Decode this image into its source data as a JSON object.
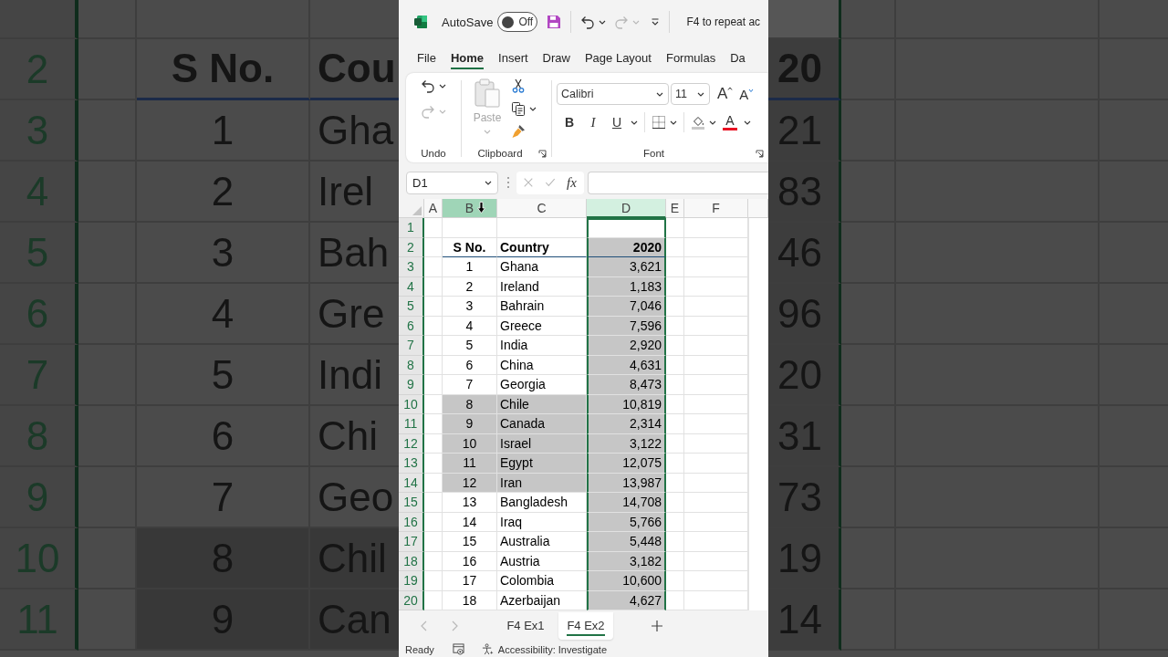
{
  "backdrop": {
    "left": {
      "rows": [
        {
          "number": "2",
          "kind": "header",
          "s_no": "S No.",
          "country": "Cou",
          "filled": false
        },
        {
          "number": "3",
          "kind": "data",
          "s_no": "1",
          "country": "Gha",
          "filled": false
        },
        {
          "number": "4",
          "kind": "data",
          "s_no": "2",
          "country": "Irel",
          "filled": false
        },
        {
          "number": "5",
          "kind": "data",
          "s_no": "3",
          "country": "Bah",
          "filled": false
        },
        {
          "number": "6",
          "kind": "data",
          "s_no": "4",
          "country": "Gre",
          "filled": false
        },
        {
          "number": "7",
          "kind": "data",
          "s_no": "5",
          "country": "Indi",
          "filled": false
        },
        {
          "number": "8",
          "kind": "data",
          "s_no": "6",
          "country": "Chi",
          "filled": false
        },
        {
          "number": "9",
          "kind": "data",
          "s_no": "7",
          "country": "Geo",
          "filled": false
        },
        {
          "number": "10",
          "kind": "data",
          "s_no": "8",
          "country": "Chil",
          "filled": true
        },
        {
          "number": "11",
          "kind": "data",
          "s_no": "9",
          "country": "Can",
          "filled": true
        }
      ]
    },
    "right": {
      "rows": [
        {
          "kind": "header",
          "value": "20",
          "filled": true
        },
        {
          "kind": "data",
          "value": "21",
          "filled": true
        },
        {
          "kind": "data",
          "value": "83",
          "filled": true
        },
        {
          "kind": "data",
          "value": "46",
          "filled": true
        },
        {
          "kind": "data",
          "value": "96",
          "filled": true
        },
        {
          "kind": "data",
          "value": "20",
          "filled": true
        },
        {
          "kind": "data",
          "value": "31",
          "filled": true
        },
        {
          "kind": "data",
          "value": "73",
          "filled": true
        },
        {
          "kind": "data",
          "value": "19",
          "filled": true
        },
        {
          "kind": "data",
          "value": "14",
          "filled": true
        }
      ]
    }
  },
  "title_bar": {
    "autosave_label": "AutoSave",
    "autosave": {
      "on": false,
      "label": "Off"
    },
    "undo": {
      "disabled": false
    },
    "redo": {
      "disabled": true
    },
    "hint": "F4 to repeat ac"
  },
  "ribbon_tabs": [
    {
      "label": "File",
      "selected": false
    },
    {
      "label": "Home",
      "selected": true
    },
    {
      "label": "Insert",
      "selected": false
    },
    {
      "label": "Draw",
      "selected": false
    },
    {
      "label": "Page Layout",
      "selected": false
    },
    {
      "label": "Formulas",
      "selected": false
    },
    {
      "label": "Da",
      "selected": false
    }
  ],
  "ribbon": {
    "undo_group": {
      "label": "Undo",
      "undo": {
        "disabled": false
      },
      "redo": {
        "disabled": true
      }
    },
    "clipboard_group": {
      "label": "Clipboard",
      "paste": {
        "label": "Paste",
        "disabled": true
      }
    },
    "font_group": {
      "label": "Font",
      "font_name": "Calibri",
      "font_size": "11",
      "grow_font": "A",
      "shrink_font": "A",
      "bold": "B",
      "italic": "I",
      "underline": "U",
      "font_color": "A"
    }
  },
  "formula_bar": {
    "name_box": "D1",
    "cancel": {
      "disabled": true
    },
    "enter": {
      "disabled": true
    },
    "fx": "fx"
  },
  "grid": {
    "columns": [
      {
        "label": "A",
        "selected": false,
        "hovered": false
      },
      {
        "label": "B",
        "selected": false,
        "hovered": true
      },
      {
        "label": "C",
        "selected": false,
        "hovered": false
      },
      {
        "label": "D",
        "selected": true,
        "hovered": false
      },
      {
        "label": "E",
        "selected": false,
        "hovered": false
      },
      {
        "label": "F",
        "selected": false,
        "hovered": false
      }
    ],
    "rows": [
      {
        "number": "1",
        "kind": "blank",
        "filled": false
      },
      {
        "number": "2",
        "kind": "header",
        "s_no": "S No.",
        "country": "Country",
        "value": "2020",
        "filled": false
      },
      {
        "number": "3",
        "kind": "data",
        "s_no": "1",
        "country": "Ghana",
        "value": "3,621",
        "filled": false
      },
      {
        "number": "4",
        "kind": "data",
        "s_no": "2",
        "country": "Ireland",
        "value": "1,183",
        "filled": false
      },
      {
        "number": "5",
        "kind": "data",
        "s_no": "3",
        "country": "Bahrain",
        "value": "7,046",
        "filled": false
      },
      {
        "number": "6",
        "kind": "data",
        "s_no": "4",
        "country": "Greece",
        "value": "7,596",
        "filled": false
      },
      {
        "number": "7",
        "kind": "data",
        "s_no": "5",
        "country": "India",
        "value": "2,920",
        "filled": false
      },
      {
        "number": "8",
        "kind": "data",
        "s_no": "6",
        "country": "China",
        "value": "4,631",
        "filled": false
      },
      {
        "number": "9",
        "kind": "data",
        "s_no": "7",
        "country": "Georgia",
        "value": "8,473",
        "filled": false
      },
      {
        "number": "10",
        "kind": "data",
        "s_no": "8",
        "country": "Chile",
        "value": "10,819",
        "filled": true
      },
      {
        "number": "11",
        "kind": "data",
        "s_no": "9",
        "country": "Canada",
        "value": "2,314",
        "filled": true
      },
      {
        "number": "12",
        "kind": "data",
        "s_no": "10",
        "country": "Israel",
        "value": "3,122",
        "filled": true
      },
      {
        "number": "13",
        "kind": "data",
        "s_no": "11",
        "country": "Egypt",
        "value": "12,075",
        "filled": true
      },
      {
        "number": "14",
        "kind": "data",
        "s_no": "12",
        "country": "Iran",
        "value": "13,987",
        "filled": true
      },
      {
        "number": "15",
        "kind": "data",
        "s_no": "13",
        "country": "Bangladesh",
        "value": "14,708",
        "filled": false
      },
      {
        "number": "16",
        "kind": "data",
        "s_no": "14",
        "country": "Iraq",
        "value": "5,766",
        "filled": false
      },
      {
        "number": "17",
        "kind": "data",
        "s_no": "15",
        "country": "Australia",
        "value": "5,448",
        "filled": false
      },
      {
        "number": "18",
        "kind": "data",
        "s_no": "16",
        "country": "Austria",
        "value": "3,182",
        "filled": false
      },
      {
        "number": "19",
        "kind": "data",
        "s_no": "17",
        "country": "Colombia",
        "value": "10,600",
        "filled": false
      },
      {
        "number": "20",
        "kind": "data",
        "s_no": "18",
        "country": "Azerbaijan",
        "value": "4,627",
        "filled": false
      }
    ]
  },
  "sheet_tabs": {
    "previous": {
      "disabled": true
    },
    "next": {
      "disabled": true
    },
    "tabs": [
      {
        "label": "F4 Ex1",
        "selected": false
      },
      {
        "label": "F4 Ex2",
        "selected": true
      }
    ]
  },
  "status_bar": {
    "status": "Ready",
    "accessibility": "Accessibility: Investigate"
  }
}
